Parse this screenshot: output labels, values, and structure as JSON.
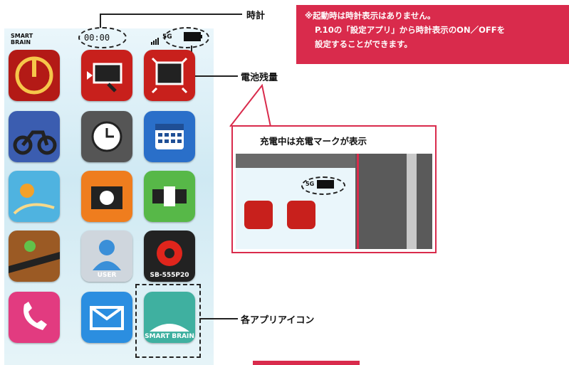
{
  "status_bar": {
    "time": "00:00",
    "network": "5G",
    "logo_top": "SMART",
    "logo_bottom": "BRAIN"
  },
  "callouts": {
    "clock": "時計",
    "battery": "電池残量",
    "app_icons": "各アプリアイコン"
  },
  "note": {
    "line1": "※起動時は時計表示はありません。",
    "line2": "P.10の「設定アプリ」から時計表示のON／OFFを",
    "line3": "設定することができます。"
  },
  "inset": {
    "title": "充電中は充電マークが表示",
    "network": "5G"
  },
  "apps": [
    {
      "name": "power"
    },
    {
      "name": "cast"
    },
    {
      "name": "mirror"
    },
    {
      "name": "motorcycle"
    },
    {
      "name": "clock"
    },
    {
      "name": "calendar"
    },
    {
      "name": "weather"
    },
    {
      "name": "camera"
    },
    {
      "name": "radio"
    },
    {
      "name": "navigation"
    },
    {
      "name": "user",
      "label": "USER"
    },
    {
      "name": "settings",
      "label": "SB-555P20"
    },
    {
      "name": "phone"
    },
    {
      "name": "mail"
    },
    {
      "name": "smartbrain-app",
      "label": "SMART BRAIN"
    }
  ],
  "colors": {
    "accent": "#d92b4c",
    "icon_red": "#c8201c"
  }
}
